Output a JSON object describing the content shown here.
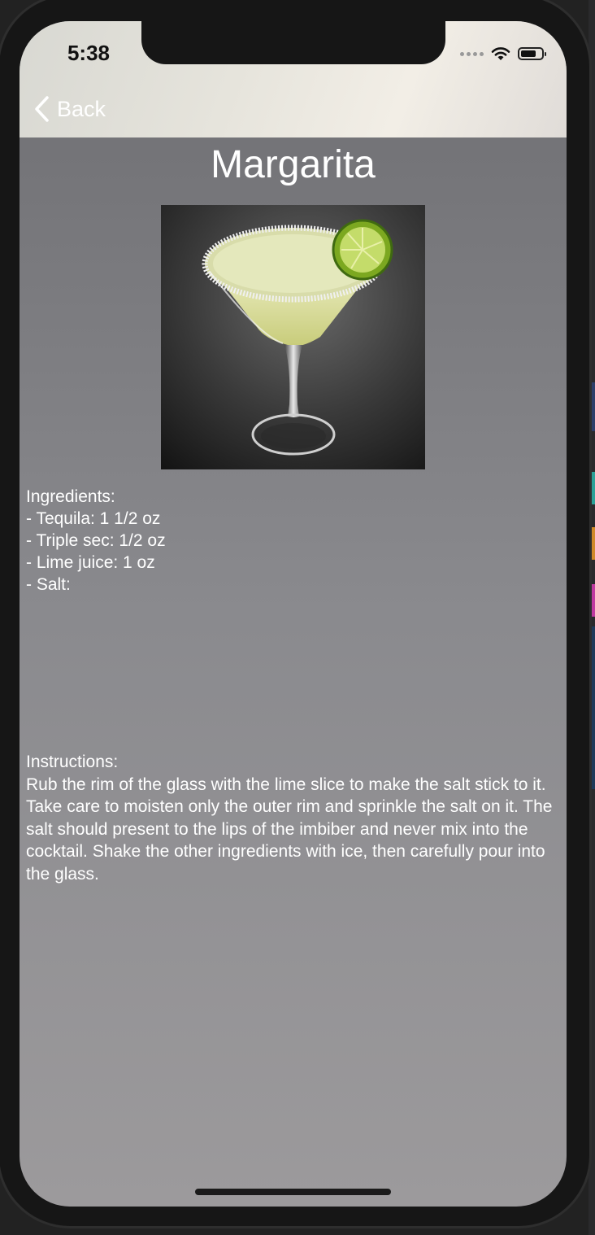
{
  "status_bar": {
    "time": "5:38"
  },
  "navigation": {
    "back_label": "Back"
  },
  "drink": {
    "name": "Margarita",
    "ingredients_heading": "Ingredients:",
    "ingredients": [
      "- Tequila: 1 1/2 oz",
      "- Triple sec: 1/2 oz",
      "- Lime juice: 1 oz",
      "- Salt:"
    ],
    "instructions_heading": "Instructions:",
    "instructions": "Rub the rim of the glass with the lime slice to make the salt stick to it. Take care to moisten only the outer rim and sprinkle the salt on it. The salt should present to the lips of the imbiber and never mix into the cocktail. Shake the other ingredients with ice, then carefully pour into the glass."
  },
  "colors": {
    "text": "#ffffff",
    "background_top": "#6e6e72",
    "background_bottom": "#9c9a9c"
  },
  "icons": [
    "chevron-left-icon",
    "wifi-icon",
    "battery-icon",
    "cellular-signal-icon"
  ]
}
